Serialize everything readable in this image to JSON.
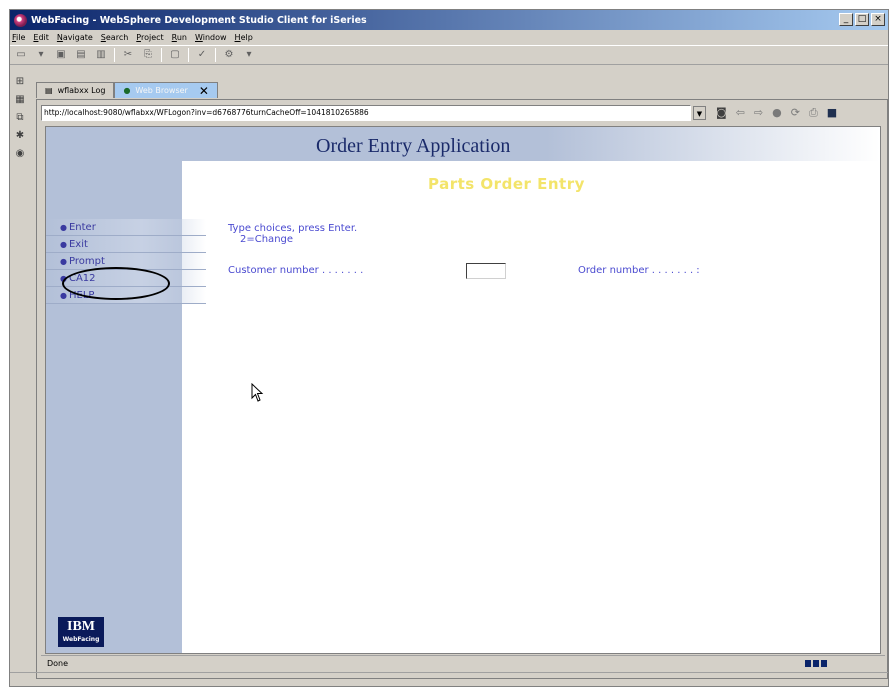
{
  "window": {
    "title": "WebFacing - WebSphere Development Studio Client for iSeries",
    "controls": {
      "minimize": "_",
      "maximize": "□",
      "close": "×"
    }
  },
  "menu": [
    "File",
    "Edit",
    "Navigate",
    "Search",
    "Project",
    "Run",
    "Window",
    "Help"
  ],
  "tabs": [
    {
      "label": "wflabxx Log",
      "active": false
    },
    {
      "label": "Web Browser",
      "active": true
    }
  ],
  "browser": {
    "url": "http://localhost:9080/wflabxx/WFLogon?inv=d6768776turnCacheOff=1041810265886",
    "status": "Done"
  },
  "page": {
    "app_title": "Order Entry Application",
    "heading": "Parts Order Entry",
    "commands": [
      "Enter",
      "Exit",
      "Prompt",
      "CA12",
      "HELP"
    ],
    "highlighted_command": "CA12",
    "instructions_line1": "Type choices, press Enter.",
    "instructions_line2": "2=Change",
    "customer_label": "Customer number . . . . . . .",
    "customer_value": "",
    "order_label": "Order number  . . . . . . . :",
    "logo_text": "IBM",
    "logo_sub": "WebFacing"
  },
  "colors": {
    "sidebar": "#b3c0d8",
    "heading": "#f3e46a",
    "field_text": "#4a4ad0",
    "title_text": "#1a2a6a"
  }
}
